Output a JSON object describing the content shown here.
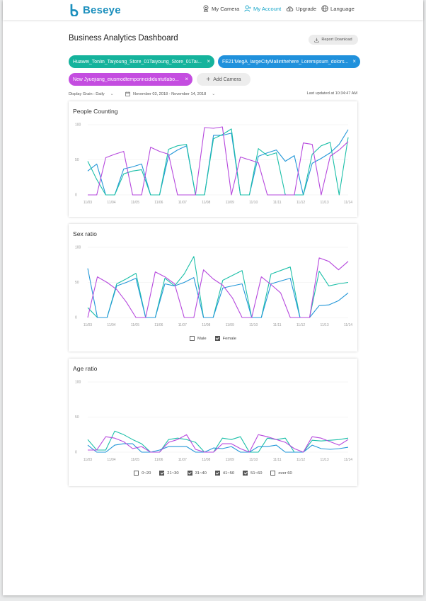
{
  "nav": {
    "brand": "Beseye",
    "items": [
      {
        "label": "My Camera",
        "icon": "camera-icon"
      },
      {
        "label": "My Account",
        "icon": "user-icon",
        "active": true
      },
      {
        "label": "Upgrade",
        "icon": "cloud-upload-icon"
      },
      {
        "label": "Language",
        "icon": "globe-icon"
      }
    ]
  },
  "header": {
    "title": "Business Analytics Dashboard",
    "report_button": "Report Download"
  },
  "cameras": [
    {
      "label": "Huawei_Tonlin_Taiyoung_Store_01Taiyoung_Store_01Tai...",
      "color": "#15b39c"
    },
    {
      "label": "FE21'MegA_largeCityMallinthehere_Loremipsum_dolors...",
      "color": "#2091dc"
    },
    {
      "label": "New Jyuejiang_eiusmodtemporincididuntutlabo...",
      "color": "#c44de0"
    }
  ],
  "add_camera": "Add Camera",
  "filters": {
    "grain": "Display Grain : Daily",
    "date_range": "November 03, 2018 - November 14, 2018",
    "updated": "Last updated at 10:34:47 AM"
  },
  "colors": {
    "green": "#1bbfa8",
    "blue": "#2397d8",
    "purple": "#b648dd"
  },
  "chart_data": [
    {
      "type": "line",
      "title": "People Counting",
      "categories": [
        "11/03",
        "11/04",
        "11/05",
        "11/06",
        "11/07",
        "11/08",
        "11/09",
        "11/10",
        "11/11",
        "11/12",
        "11/13",
        "11/14"
      ],
      "ylim": [
        0,
        100
      ],
      "yticks": [
        "100",
        "50",
        "0"
      ],
      "grid": true,
      "series": [
        {
          "color": "#2397d8",
          "values": [
            34,
            44,
            0,
            0,
            37,
            40,
            44,
            0,
            0,
            56,
            64,
            70,
            0,
            0,
            85,
            85,
            88,
            0,
            0,
            55,
            60,
            64,
            48,
            56,
            0,
            45,
            52,
            60,
            72,
            93
          ]
        },
        {
          "color": "#1bbfa8",
          "values": [
            48,
            22,
            0,
            0,
            30,
            34,
            36,
            0,
            0,
            65,
            70,
            72,
            0,
            0,
            80,
            86,
            94,
            0,
            0,
            66,
            56,
            60,
            0,
            0,
            0,
            58,
            70,
            75,
            0,
            82
          ]
        },
        {
          "color": "#b648dd",
          "values": [
            0,
            0,
            53,
            58,
            62,
            0,
            0,
            68,
            62,
            58,
            0,
            0,
            0,
            96,
            95,
            97,
            0,
            54,
            50,
            46,
            0,
            0,
            0,
            0,
            74,
            72,
            0,
            55,
            64,
            76
          ]
        }
      ]
    },
    {
      "type": "line",
      "title": "Sex ratio",
      "categories": [
        "11/03",
        "11/04",
        "11/05",
        "11/06",
        "11/07",
        "11/08",
        "11/09",
        "11/10",
        "11/11",
        "11/12",
        "11/13",
        "11/14"
      ],
      "ylim": [
        0,
        100
      ],
      "yticks": [
        "100",
        "50",
        "0"
      ],
      "grid": true,
      "legend": [
        {
          "label": "Male",
          "checked": false
        },
        {
          "label": "Female",
          "checked": true
        }
      ],
      "series": [
        {
          "color": "#1bbfa8",
          "values": [
            14,
            0,
            0,
            48,
            55,
            63,
            0,
            0,
            56,
            45,
            62,
            87,
            0,
            0,
            53,
            60,
            67,
            0,
            0,
            62,
            67,
            72,
            0,
            0,
            66,
            45,
            48,
            50
          ]
        },
        {
          "color": "#2397d8",
          "values": [
            70,
            0,
            0,
            45,
            50,
            56,
            0,
            0,
            48,
            45,
            50,
            57,
            0,
            0,
            42,
            45,
            48,
            0,
            0,
            48,
            52,
            56,
            0,
            0,
            17,
            18,
            24,
            35
          ]
        },
        {
          "color": "#b648dd",
          "values": [
            0,
            58,
            50,
            40,
            22,
            0,
            0,
            65,
            58,
            48,
            0,
            0,
            68,
            55,
            46,
            28,
            0,
            0,
            58,
            47,
            35,
            0,
            0,
            0,
            85,
            80,
            68,
            80
          ]
        }
      ]
    },
    {
      "type": "line",
      "title": "Age ratio",
      "categories": [
        "11/03",
        "11/04",
        "11/05",
        "11/06",
        "11/07",
        "11/08",
        "11/09",
        "11/10",
        "11/11",
        "11/12",
        "11/13",
        "11/14"
      ],
      "ylim": [
        0,
        100
      ],
      "yticks": [
        "100",
        "50",
        "0"
      ],
      "grid": true,
      "legend": [
        {
          "label": "0~20",
          "checked": false
        },
        {
          "label": "21~30",
          "checked": true
        },
        {
          "label": "31~40",
          "checked": true
        },
        {
          "label": "41~50",
          "checked": true
        },
        {
          "label": "51~60",
          "checked": true
        },
        {
          "label": "over 60",
          "checked": false
        }
      ],
      "series": [
        {
          "color": "#1bbfa8",
          "values": [
            18,
            3,
            3,
            30,
            25,
            18,
            12,
            0,
            0,
            18,
            20,
            18,
            14,
            0,
            0,
            20,
            18,
            22,
            0,
            0,
            20,
            18,
            20,
            0,
            0,
            17,
            16,
            17,
            18,
            20
          ]
        },
        {
          "color": "#2397d8",
          "values": [
            10,
            0,
            0,
            10,
            12,
            12,
            0,
            0,
            3,
            8,
            8,
            8,
            0,
            0,
            6,
            5,
            8,
            0,
            0,
            8,
            8,
            10,
            0,
            0,
            0,
            10,
            5,
            4,
            5,
            7
          ]
        },
        {
          "color": "#b648dd",
          "values": [
            3,
            3,
            22,
            20,
            15,
            5,
            8,
            0,
            0,
            14,
            18,
            25,
            4,
            0,
            0,
            12,
            12,
            5,
            0,
            25,
            22,
            18,
            14,
            5,
            0,
            22,
            20,
            15,
            10,
            18
          ]
        }
      ]
    }
  ]
}
